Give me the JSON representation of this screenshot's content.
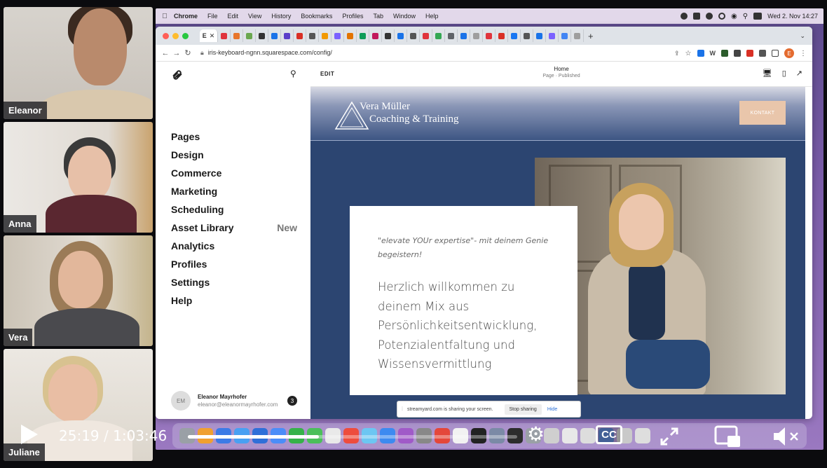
{
  "participants": [
    {
      "name": "Eleanor"
    },
    {
      "name": "Anna"
    },
    {
      "name": "Vera"
    },
    {
      "name": "Juliane"
    }
  ],
  "mac_menubar": {
    "app": "Chrome",
    "items": [
      "File",
      "Edit",
      "View",
      "History",
      "Bookmarks",
      "Profiles",
      "Tab",
      "Window",
      "Help"
    ],
    "clock": "Wed 2. Nov  14:27"
  },
  "browser": {
    "url": "iris-keyboard-ngnn.squarespace.com/config/",
    "active_tab_icon": "E",
    "profile_initial": "E",
    "tab_icon_colors": [
      "#e0343c",
      "#e8762b",
      "#6aa84f",
      "#333333",
      "#1a73e8",
      "#5b3fc9",
      "#d93025",
      "#555555",
      "#f29900",
      "#7b61ff",
      "#e37400",
      "#0f9d58",
      "#c2185b",
      "#333333",
      "#1a73e8",
      "#555555",
      "#e0343c",
      "#34a853",
      "#5f6368",
      "#1a73e8",
      "#9e9e9e",
      "#e0343c",
      "#d93025",
      "#1877f2",
      "#555555",
      "#1a73e8",
      "#7b61ff",
      "#4285f4",
      "#9e9e9e"
    ]
  },
  "squarespace": {
    "nav": [
      {
        "label": "Pages",
        "badge": ""
      },
      {
        "label": "Design",
        "badge": ""
      },
      {
        "label": "Commerce",
        "badge": ""
      },
      {
        "label": "Marketing",
        "badge": ""
      },
      {
        "label": "Scheduling",
        "badge": ""
      },
      {
        "label": "Asset Library",
        "badge": "New"
      },
      {
        "label": "Analytics",
        "badge": ""
      },
      {
        "label": "Profiles",
        "badge": ""
      },
      {
        "label": "Settings",
        "badge": ""
      },
      {
        "label": "Help",
        "badge": ""
      }
    ],
    "user": {
      "initials": "EM",
      "name": "Eleanor Mayrhofer",
      "email": "eleanor@eleanormayrhofer.com",
      "notifications": "3"
    },
    "editor": {
      "edit_label": "EDIT",
      "page_title": "Home",
      "page_status": "Page · Published"
    }
  },
  "site": {
    "brand_line1": "Vera Müller",
    "brand_line2": "Coaching & Training",
    "cta": "KONTAKT",
    "quote": "\"elevate YOUr expertise\"- mit deinem Genie begeistern!",
    "welcome_lines": [
      "Herzlich willkommen zu",
      "deinem Mix aus",
      "Persönlichkeitsentwicklung,",
      "Potenzialentfaltung und",
      "Wissensvermittlung"
    ],
    "colors": {
      "navy": "#2c4571",
      "cta": "#e9c6ab"
    }
  },
  "share_banner": {
    "message": "streamyard.com is sharing your screen.",
    "stop": "Stop sharing",
    "hide": "Hide"
  },
  "player": {
    "current_time": "25:19",
    "separator": "/",
    "duration": "1:03:46",
    "progress_fraction": 0.397,
    "cc_label": "CC",
    "icons": [
      "play-icon",
      "settings-gear-icon",
      "closed-captions-icon",
      "fullscreen-icon",
      "picture-in-picture-icon",
      "volume-muted-icon"
    ]
  },
  "dock_icon_colors": [
    "#9aa0a6",
    "#f0a030",
    "#3c7be6",
    "#49a0f2",
    "#2f6fd8",
    "#4b8df8",
    "#36b24a",
    "#4bbf5a",
    "#e9e9e9",
    "#ee4c3d",
    "#6cc6f2",
    "#3c8af0",
    "#a05ac8",
    "#888888",
    "#e4473a",
    "#f2f2f2",
    "#222222",
    "#7b8aa6",
    "#2c2c2c",
    "#9aa0a6",
    "#cfcfcf",
    "#e8e8e8",
    "#dddddd",
    "#5a80c8",
    "#c9c9c9",
    "#dedede"
  ]
}
